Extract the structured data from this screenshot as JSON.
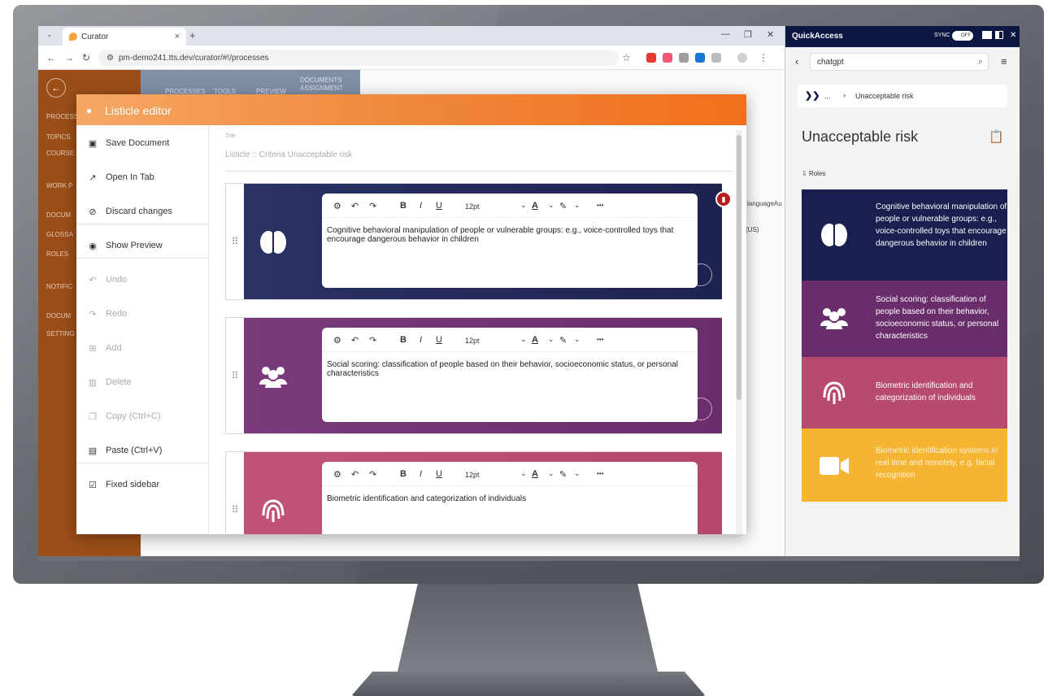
{
  "browser": {
    "tab_title": "Curator",
    "url": "pm-demo241.tts.dev/curator/#!/processes",
    "tab_close": "×",
    "tab_add": "+"
  },
  "app": {
    "sidebar_items": [
      "PROCESS",
      "TOPICS",
      "COURSE",
      "WORK P",
      "DOCUM",
      "GLOSSA",
      "ROLES",
      "NOTIFIC",
      "DOCUM",
      "SETTING"
    ],
    "tabs": [
      "PROCESSES",
      "TOOLS",
      "PREVIEW",
      "DOCUMENTS ASSIGNMENT"
    ],
    "bg_text_1": "languageAu",
    "bg_text_2": "(US)"
  },
  "modal": {
    "title": "Listicle editor",
    "actions": [
      {
        "label": "Save Document",
        "icon": "save-icon",
        "enabled": true
      },
      {
        "label": "Open In Tab",
        "icon": "open-in-tab-icon",
        "enabled": true
      },
      {
        "label": "Discard changes",
        "icon": "discard-icon",
        "enabled": true
      },
      {
        "label": "Show Preview",
        "icon": "eye-icon",
        "enabled": true
      },
      {
        "label": "Undo",
        "icon": "undo-icon",
        "enabled": false
      },
      {
        "label": "Redo",
        "icon": "redo-icon",
        "enabled": false
      },
      {
        "label": "Add",
        "icon": "add-icon",
        "enabled": false
      },
      {
        "label": "Delete",
        "icon": "delete-icon",
        "enabled": false
      },
      {
        "label": "Copy (Ctrl+C)",
        "icon": "copy-icon",
        "enabled": false
      },
      {
        "label": "Paste (Ctrl+V)",
        "icon": "paste-icon",
        "enabled": true
      },
      {
        "label": "Fixed sidebar",
        "icon": "checkbox-icon",
        "enabled": true
      }
    ],
    "field_label": "Title",
    "field_value": "Listicle :: Criteria Unacceptable risk",
    "toolbar": {
      "bold": "B",
      "italic": "I",
      "underline": "U",
      "font_size": "12pt",
      "more": "•••"
    },
    "cards": [
      {
        "color": "#1e2350",
        "icon": "brain-icon",
        "text": "Cognitive behavioral manipulation of people or vulnerable groups: e.g., voice-controlled toys that encourage dangerous behavior in children"
      },
      {
        "color": "#6a2d6b",
        "icon": "group-icon",
        "text": "Social scoring: classification of people based on their behavior, socioeconomic status, or personal characteristics"
      },
      {
        "color": "#b3486a",
        "icon": "fingerprint-icon",
        "text": "Biometric identification and categorization of individuals"
      }
    ]
  },
  "quickaccess": {
    "title": "QuickAccess",
    "sync_label": "SYNC",
    "toggle_label": "OFF",
    "search_value": "chatgpt",
    "breadcrumb_dots": "...",
    "breadcrumb_label": "Unacceptable risk",
    "page_title": "Unacceptable risk",
    "roles_label": "Roles",
    "blocks": [
      {
        "color": "#1a1f4f",
        "text_color": "#ffffff",
        "icon": "brain-icon",
        "text": "Cognitive behavioral manipulation of people or vulnerable groups: e.g., voice-controlled toys that encourage dangerous behavior in children"
      },
      {
        "color": "#6a2d6b",
        "text_color": "#ffffff",
        "icon": "group-icon",
        "text": "Social scoring: classification of people based on their behavior, socioeconomic status, or personal characteristics"
      },
      {
        "color": "#b84a6d",
        "text_color": "#ffffff",
        "icon": "fingerprint-icon",
        "text": "Biometric identification and categorization of individuals"
      },
      {
        "color": "#f5b431",
        "text_color": "#fdf3d6",
        "icon": "video-camera-icon",
        "text": "Biometric identification systems in real time and remotely, e.g. facial recognition"
      }
    ]
  }
}
